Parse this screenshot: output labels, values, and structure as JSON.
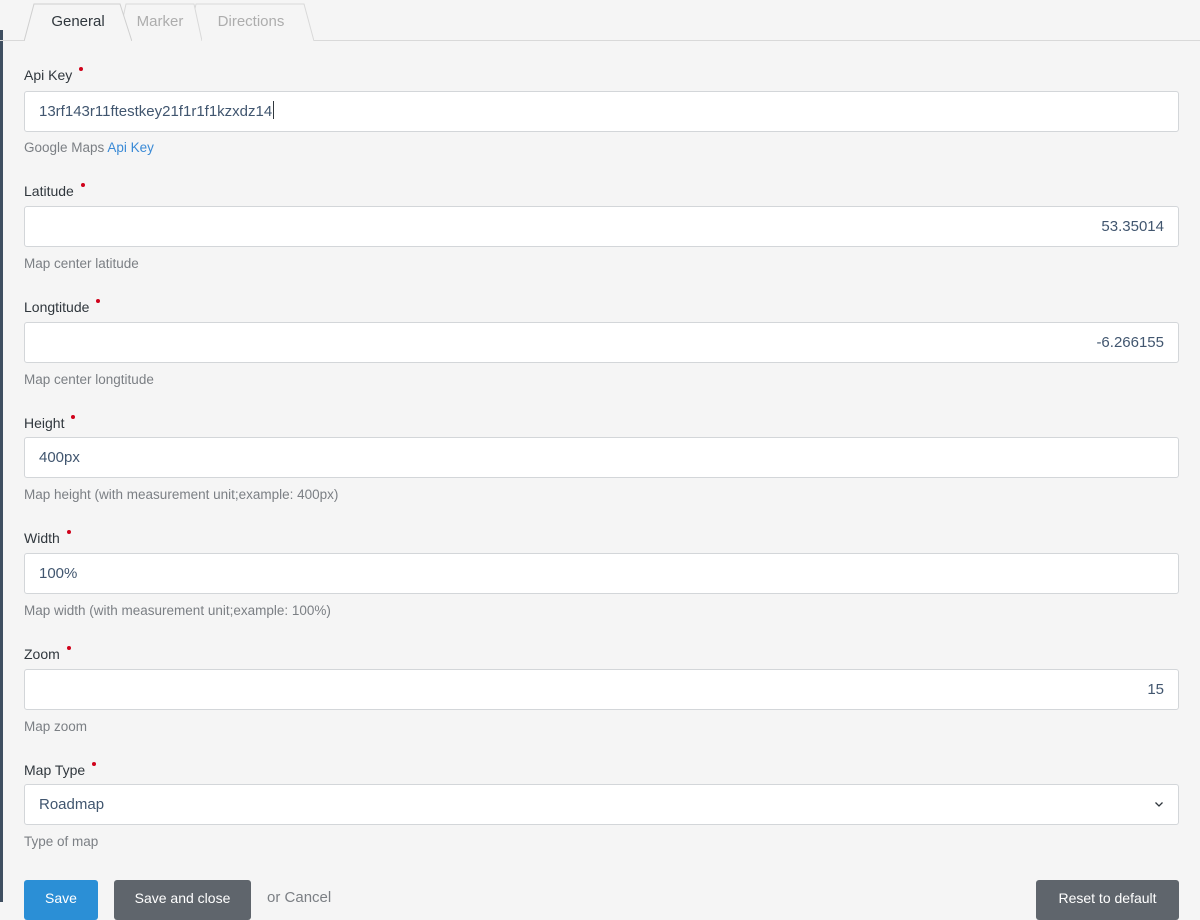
{
  "tabs": [
    {
      "label": "General",
      "active": true
    },
    {
      "label": "Marker",
      "active": false
    },
    {
      "label": "Directions",
      "active": false
    }
  ],
  "fields": {
    "api_key": {
      "label": "Api Key",
      "value": "13rf143r11ftestkey21f1r1f1kzxdz14",
      "help_prefix": "Google Maps ",
      "help_link": "Api Key"
    },
    "latitude": {
      "label": "Latitude",
      "value": "53.35014",
      "help": "Map center latitude"
    },
    "longitude": {
      "label": "Longtitude",
      "value": "-6.266155",
      "help": "Map center longtitude"
    },
    "height": {
      "label": "Height",
      "value": "400px",
      "help": "Map height (with measurement unit;example: 400px)"
    },
    "width": {
      "label": "Width",
      "value": "100%",
      "help": "Map width (with measurement unit;example: 100%)"
    },
    "zoom": {
      "label": "Zoom",
      "value": "15",
      "help": "Map zoom"
    },
    "map_type": {
      "label": "Map Type",
      "value": "Roadmap",
      "help": "Type of map"
    }
  },
  "actions": {
    "save": "Save",
    "save_close": "Save and close",
    "or": "or ",
    "cancel": "Cancel",
    "reset": "Reset to default"
  },
  "colors": {
    "primary": "#2b8fd6",
    "secondary": "#5f656c",
    "required": "#d0021b",
    "link": "#3a8ad6"
  }
}
